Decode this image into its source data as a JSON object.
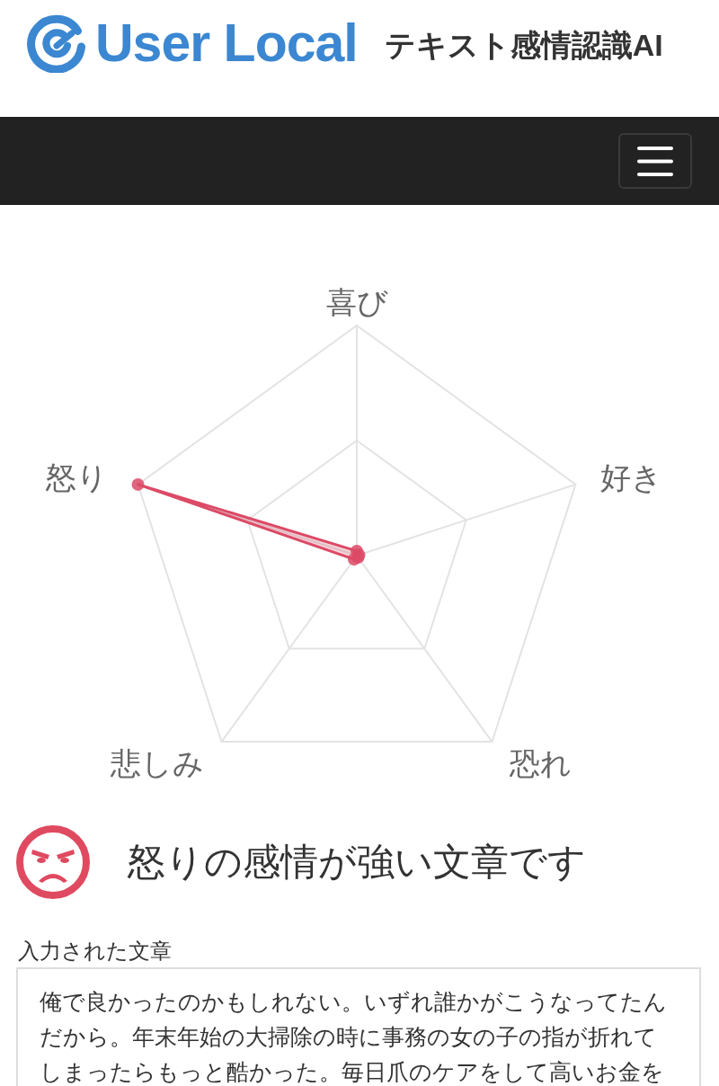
{
  "header": {
    "logo_text": "User Local",
    "product_name": "テキスト感情認識AI"
  },
  "emotion_chart": {
    "axes": [
      "喜び",
      "好き",
      "恐れ",
      "悲しみ",
      "怒り"
    ]
  },
  "result": {
    "title": "怒りの感情が強い文章です"
  },
  "input_text": {
    "label": "入力された文章",
    "value": "俺で良かったのかもしれない。いずれ誰かがこうなってたんだから。年末年始の大掃除の時に事務の女の子の指が折れてしまったらもっと酷かった。毎日爪のケアをして高いお金を"
  }
}
